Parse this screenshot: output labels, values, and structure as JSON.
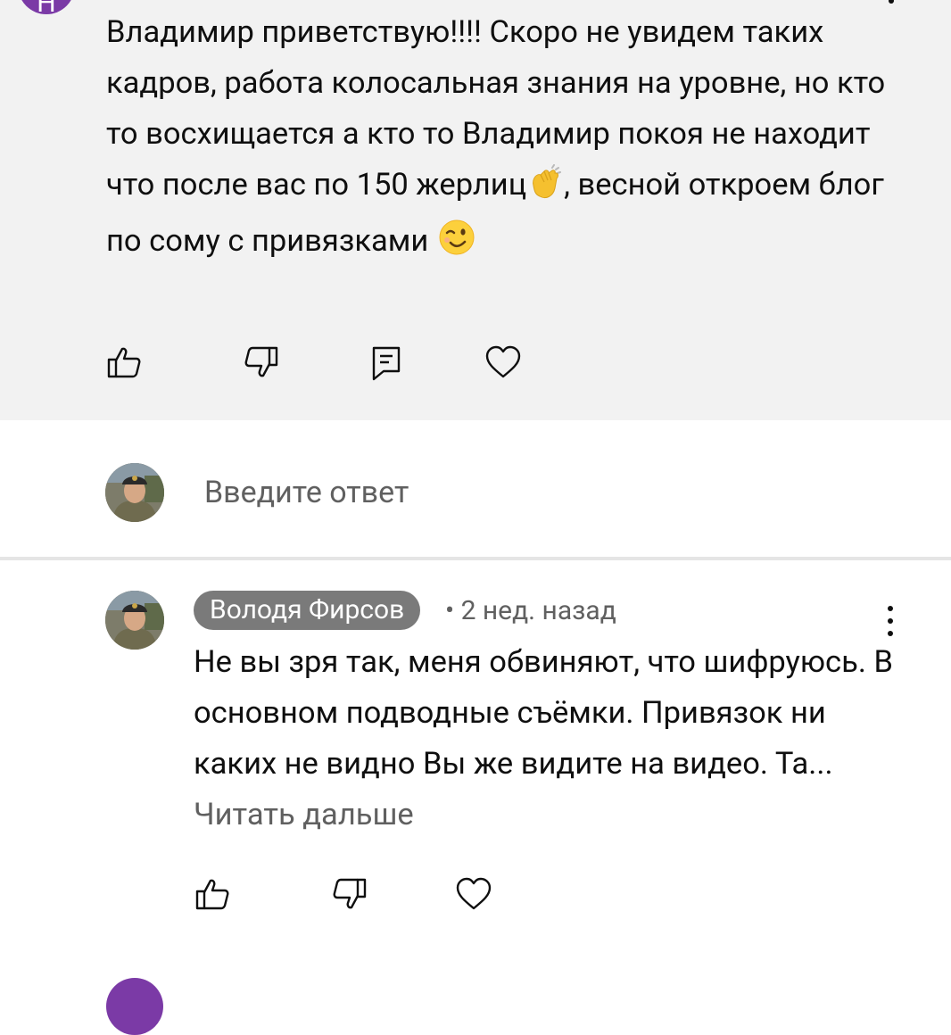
{
  "top_comment": {
    "avatar_letter": "Н",
    "text_before_emoji1": "Владимир приветствую!!!! Скоро не увидем таких кадров, работа колосальная знания на уровне, но кто то восхищается а кто то Владимир покоя не находит что после вас по 150 жерлиц",
    "emoji1": "clapping-hands",
    "text_between_emojis": ", весной откроем блог по сому с привязками ",
    "emoji2": "winking-face",
    "actions": [
      "like-icon",
      "dislike-icon",
      "reply-icon",
      "heart-icon"
    ]
  },
  "reply_box": {
    "placeholder": "Введите ответ"
  },
  "reply": {
    "author": "Володя Фирсов",
    "meta": "• 2 нед. назад",
    "text": "Не вы зря так, меня обвиняют, что шифруюсь. В основном подводные съёмки. Привязок ни каких не видно Вы же видите на видео. Та...",
    "read_more": "Читать дальше",
    "actions": [
      "like-icon",
      "dislike-icon",
      "heart-icon"
    ]
  },
  "colors": {
    "highlight_bg": "#f2f2f2",
    "text": "#0f0f0f",
    "secondary_text": "#606060",
    "author_chip_bg": "#7a7a7a",
    "avatar_purple": "#7b3aa6"
  }
}
